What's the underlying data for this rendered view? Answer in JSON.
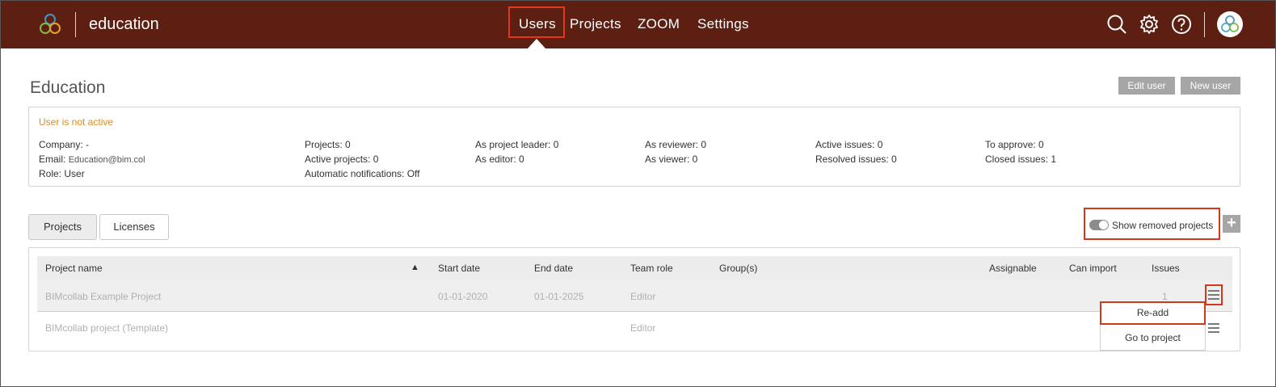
{
  "header": {
    "brand": "education",
    "nav": [
      {
        "label": "Users"
      },
      {
        "label": "Projects"
      },
      {
        "label": "ZOOM"
      },
      {
        "label": "Settings"
      }
    ],
    "icons": [
      "search-icon",
      "gear-icon",
      "help-icon",
      "user-avatar"
    ]
  },
  "page": {
    "title": "Education",
    "edit_user_label": "Edit user",
    "new_user_label": "New user"
  },
  "info": {
    "status": "User is not active",
    "company": "Company: -",
    "email_label": "Email:",
    "email_value": "Education@bim.col",
    "role": "Role: User",
    "projects": "Projects: 0",
    "active_projects": "Active projects: 0",
    "auto_notifications": "Automatic notifications: Off",
    "as_project_leader": "As project leader: 0",
    "as_editor": "As editor: 0",
    "as_reviewer": "As reviewer: 0",
    "as_viewer": "As viewer: 0",
    "active_issues": "Active issues: 0",
    "resolved_issues": "Resolved issues: 0",
    "to_approve": "To approve: 0",
    "closed_issues": "Closed issues: 1"
  },
  "tabs": {
    "projects": "Projects",
    "licenses": "Licenses"
  },
  "show_removed_label": "Show removed projects",
  "plus_label": "+",
  "table": {
    "headers": {
      "project_name": "Project name",
      "sort_indicator": "▲",
      "start_date": "Start date",
      "end_date": "End date",
      "team_role": "Team role",
      "groups": "Group(s)",
      "assignable": "Assignable",
      "can_import": "Can import",
      "issues": "Issues"
    },
    "rows": [
      {
        "name": "BIMcollab Example Project",
        "start": "01-01-2020",
        "end": "01-01-2025",
        "role": "Editor",
        "issues": "1"
      },
      {
        "name": "BIMcollab project (Template)",
        "start": "",
        "end": "",
        "role": "Editor",
        "issues": ""
      }
    ]
  },
  "context_menu": {
    "readd": "Re-add",
    "goto": "Go to project"
  },
  "colors": {
    "header_bg": "#5c1f12",
    "highlight": "#d1381c",
    "status": "#e08a1e"
  }
}
